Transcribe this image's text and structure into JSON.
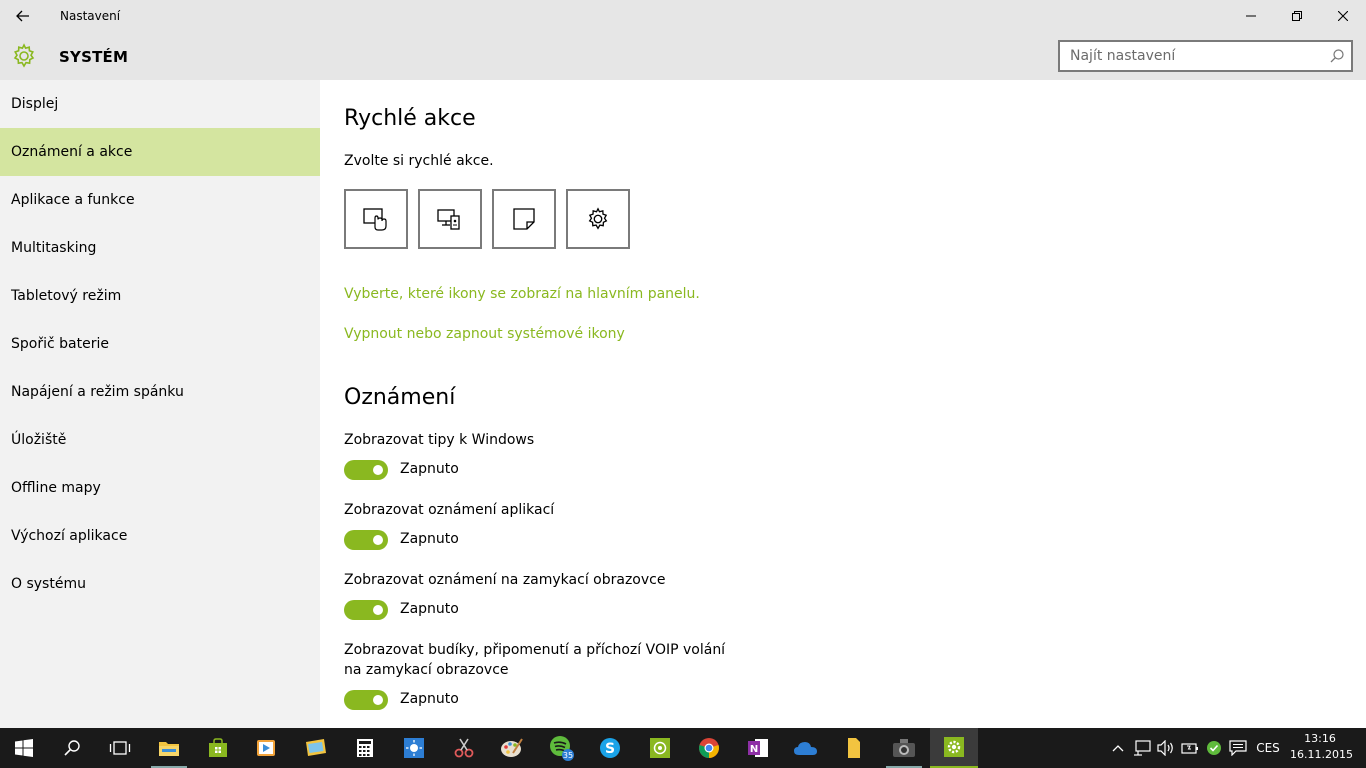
{
  "window": {
    "title": "Nastavení"
  },
  "header": {
    "title": "SYSTÉM",
    "search_placeholder": "Najít nastavení",
    "accent": "#8ab820"
  },
  "sidebar": {
    "items": [
      {
        "label": "Displej",
        "active": false
      },
      {
        "label": "Oznámení a akce",
        "active": true
      },
      {
        "label": "Aplikace a funkce",
        "active": false
      },
      {
        "label": "Multitasking",
        "active": false
      },
      {
        "label": "Tabletový režim",
        "active": false
      },
      {
        "label": "Spořič baterie",
        "active": false
      },
      {
        "label": "Napájení a režim spánku",
        "active": false
      },
      {
        "label": "Úložiště",
        "active": false
      },
      {
        "label": "Offline mapy",
        "active": false
      },
      {
        "label": "Výchozí aplikace",
        "active": false
      },
      {
        "label": "O systému",
        "active": false
      }
    ]
  },
  "quick_actions": {
    "heading": "Rychlé akce",
    "description": "Zvolte si rychlé akce.",
    "tiles": [
      "tablet-mode-icon",
      "connect-icon",
      "note-icon",
      "settings-gear-icon"
    ],
    "link_taskbar_icons": "Vyberte, které ikony se zobrazí na hlavním panelu.",
    "link_system_icons": "Vypnout nebo zapnout systémové ikony"
  },
  "notifications": {
    "heading": "Oznámení",
    "options": [
      {
        "label": "Zobrazovat tipy k Windows",
        "state": "Zapnuto"
      },
      {
        "label": "Zobrazovat oznámení aplikací",
        "state": "Zapnuto"
      },
      {
        "label": "Zobrazovat oznámení na zamykací obrazovce",
        "state": "Zapnuto"
      },
      {
        "label": "Zobrazovat budíky, připomenutí a příchozí VOIP volání na zamykací obrazovce",
        "state": "Zapnuto"
      }
    ]
  },
  "taskbar": {
    "spotify_badge": "35",
    "language": "CES",
    "time": "13:16",
    "date": "16.11.2015"
  }
}
